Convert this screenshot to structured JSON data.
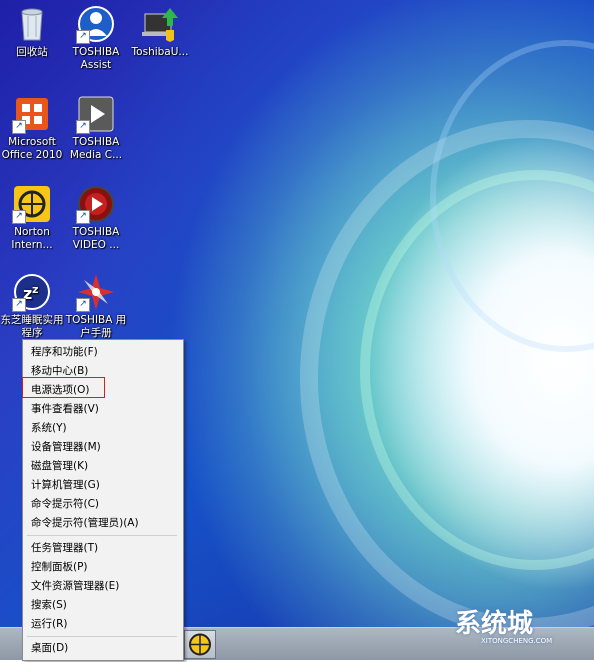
{
  "desktop_icons": [
    {
      "label": "回收站",
      "icon": "recycle-bin-icon"
    },
    {
      "label": "TOSHIBA Assist",
      "icon": "toshiba-assist-icon"
    },
    {
      "label": "ToshibaU...",
      "icon": "toshiba-update-icon"
    },
    {
      "label": "Microsoft Office 2010",
      "icon": "office-icon"
    },
    {
      "label": "TOSHIBA Media C...",
      "icon": "media-player-icon"
    },
    {
      "label": "Norton Intern...",
      "icon": "norton-icon"
    },
    {
      "label": "TOSHIBA VIDEO ...",
      "icon": "video-player-icon"
    },
    {
      "label": "东芝睡眠实用程序",
      "icon": "sleep-utility-icon"
    },
    {
      "label": "TOSHIBA 用户手册",
      "icon": "user-manual-icon"
    }
  ],
  "context_menu": {
    "group1": [
      "程序和功能(F)",
      "移动中心(B)",
      "电源选项(O)",
      "事件查看器(V)",
      "系统(Y)",
      "设备管理器(M)",
      "磁盘管理(K)",
      "计算机管理(G)",
      "命令提示符(C)",
      "命令提示符(管理员)(A)"
    ],
    "group2": [
      "任务管理器(T)",
      "控制面板(P)",
      "文件资源管理器(E)",
      "搜索(S)",
      "运行(R)"
    ],
    "group3": [
      "桌面(D)"
    ],
    "highlighted": "电源选项(O)"
  },
  "watermark": {
    "text": "系统城",
    "sub": "XITONGCHENG.COM"
  },
  "colors": {
    "highlight_border": "#d42020",
    "menu_bg": "#f2f2f2"
  }
}
